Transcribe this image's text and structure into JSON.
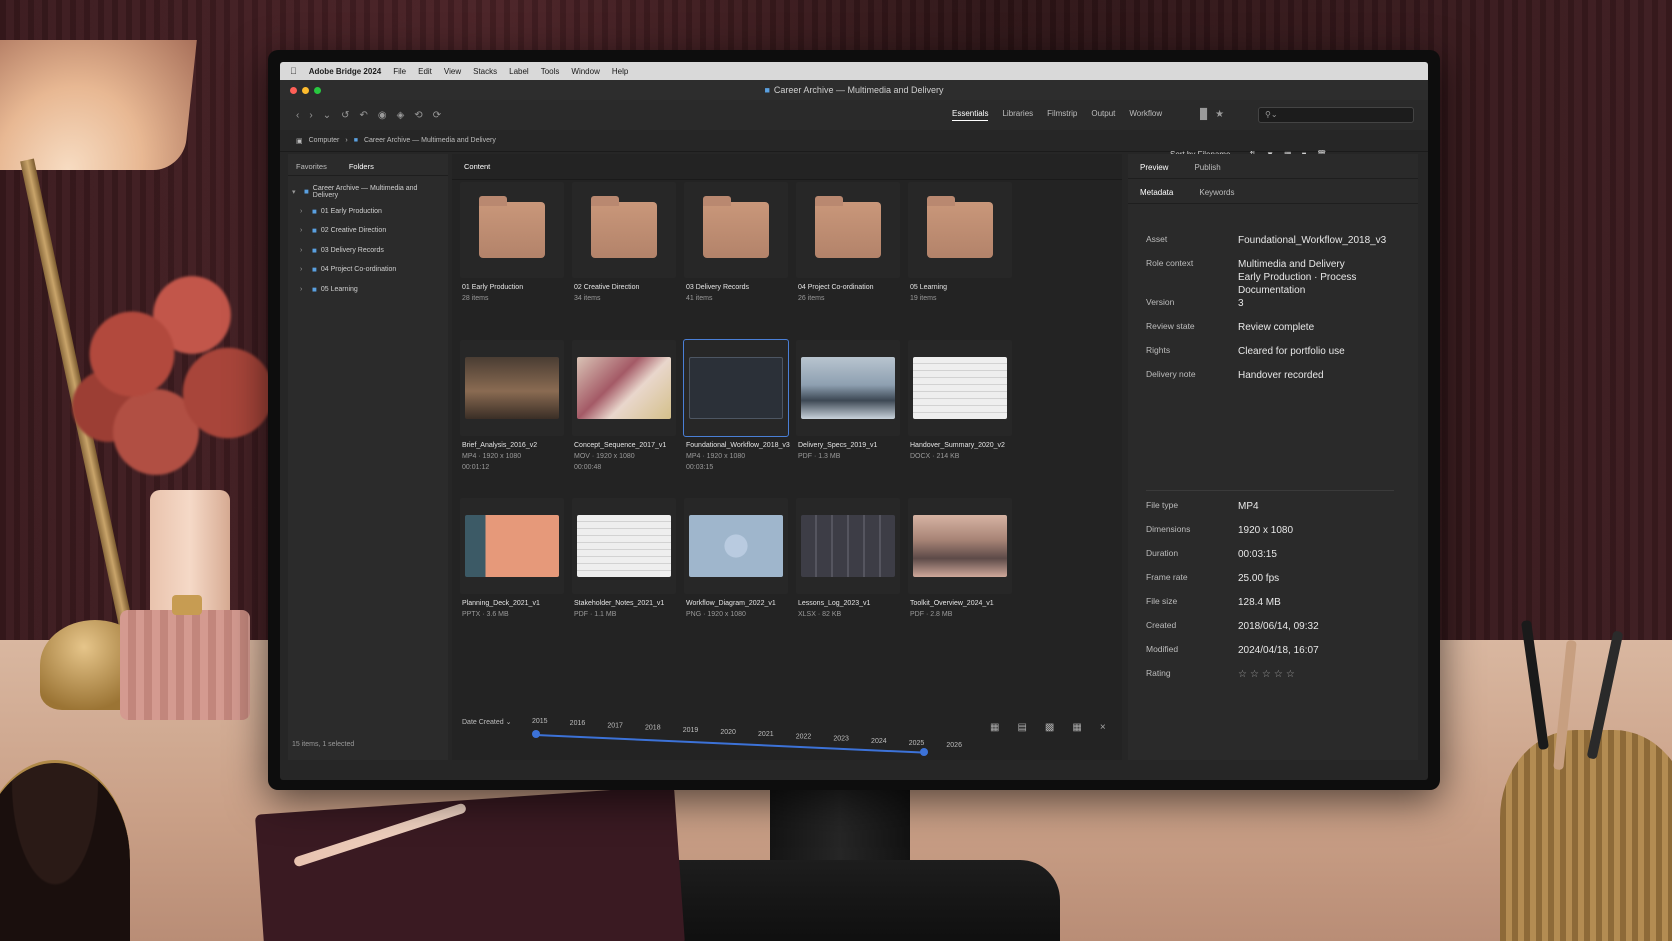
{
  "menubar": {
    "app": "Adobe Bridge 2024",
    "items": [
      "File",
      "Edit",
      "View",
      "Stacks",
      "Label",
      "Tools",
      "Window",
      "Help"
    ]
  },
  "window": {
    "title": "Career Archive — Multimedia and Delivery"
  },
  "workspaces": {
    "items": [
      "Essentials",
      "Libraries",
      "Filmstrip",
      "Output",
      "Workflow"
    ],
    "active": "Essentials"
  },
  "path": {
    "root": "Computer",
    "current": "Career Archive — Multimedia and Delivery"
  },
  "sort": {
    "label": "Sort by Filename"
  },
  "left_panel": {
    "tabs": [
      "Favorites",
      "Folders"
    ],
    "tree_root": "Career Archive — Multimedia and Delivery",
    "folders": [
      "01 Early Production",
      "02 Creative Direction",
      "03 Delivery Records",
      "04 Project Co-ordination",
      "05 Learning"
    ],
    "status": "15 items, 1 selected"
  },
  "content": {
    "tab": "Content",
    "items": [
      {
        "name": "01 Early Production",
        "meta1": "28 items",
        "meta2": "",
        "kind": "folder"
      },
      {
        "name": "02 Creative Direction",
        "meta1": "34 items",
        "meta2": "",
        "kind": "folder"
      },
      {
        "name": "03 Delivery Records",
        "meta1": "41 items",
        "meta2": "",
        "kind": "folder"
      },
      {
        "name": "04 Project Co-ordination",
        "meta1": "26 items",
        "meta2": "",
        "kind": "folder"
      },
      {
        "name": "05 Learning",
        "meta1": "19 items",
        "meta2": "",
        "kind": "folder"
      },
      {
        "name": "Brief_Analysis_2016_v2",
        "meta1": "MP4 · 1920 x 1080",
        "meta2": "00:01:12",
        "kind": "photo-desk"
      },
      {
        "name": "Concept_Sequence_2017_v1",
        "meta1": "MOV · 1920 x 1080",
        "meta2": "00:00:48",
        "kind": "photo-moodboard"
      },
      {
        "name": "Foundational_Workflow_2018_v3",
        "meta1": "MP4 · 1920 x 1080",
        "meta2": "00:03:15",
        "kind": "photo-diagram",
        "selected": true
      },
      {
        "name": "Delivery_Specs_2019_v1",
        "meta1": "PDF · 1.3 MB",
        "meta2": "",
        "kind": "photo-mountain"
      },
      {
        "name": "Handover_Summary_2020_v2",
        "meta1": "DOCX · 214 KB",
        "meta2": "",
        "kind": "photo-doc"
      },
      {
        "name": "Planning_Deck_2021_v1",
        "meta1": "PPTX · 3.6 MB",
        "meta2": "",
        "kind": "photo-slide"
      },
      {
        "name": "Stakeholder_Notes_2021_v1",
        "meta1": "PDF · 1.1 MB",
        "meta2": "",
        "kind": "photo-doc"
      },
      {
        "name": "Workflow_Diagram_2022_v1",
        "meta1": "PNG · 1920 x 1080",
        "meta2": "",
        "kind": "photo-flow"
      },
      {
        "name": "Lessons_Log_2023_v1",
        "meta1": "XLSX · 82 KB",
        "meta2": "",
        "kind": "photo-sheet"
      },
      {
        "name": "Toolkit_Overview_2024_v1",
        "meta1": "PDF · 2.8 MB",
        "meta2": "",
        "kind": "photo-dusk"
      }
    ]
  },
  "timeline": {
    "label": "Date Created",
    "years": [
      "2015",
      "2016",
      "2017",
      "2018",
      "2019",
      "2020",
      "2021",
      "2022",
      "2023",
      "2024",
      "2025",
      "2026"
    ]
  },
  "right_panel": {
    "tabs_top": [
      "Preview",
      "Publish"
    ],
    "tabs_bottom": [
      "Metadata",
      "Keywords"
    ],
    "details": [
      {
        "key": "Asset",
        "value": "Foundational_Workflow_2018_v3"
      },
      {
        "key": "Role context",
        "value": "Multimedia and Delivery\nEarly Production · Process\nDocumentation"
      },
      {
        "key": "Version",
        "value": "3"
      },
      {
        "key": "Review state",
        "value": "Review complete"
      },
      {
        "key": "Rights",
        "value": "Cleared for portfolio use"
      },
      {
        "key": "Delivery note",
        "value": "Handover recorded"
      }
    ],
    "file_info": [
      {
        "key": "File type",
        "value": "MP4"
      },
      {
        "key": "Dimensions",
        "value": "1920 x 1080"
      },
      {
        "key": "Duration",
        "value": "00:03:15"
      },
      {
        "key": "Frame rate",
        "value": "25.00 fps"
      },
      {
        "key": "File size",
        "value": "128.4 MB"
      },
      {
        "key": "Created",
        "value": "2018/06/14, 09:32"
      },
      {
        "key": "Modified",
        "value": "2024/04/18, 16:07"
      },
      {
        "key": "Rating",
        "value": "☆☆☆☆☆"
      }
    ]
  },
  "colors": {
    "accent": "#3c72d8",
    "folder": "#c9977a",
    "panel": "#2a2a2a"
  }
}
